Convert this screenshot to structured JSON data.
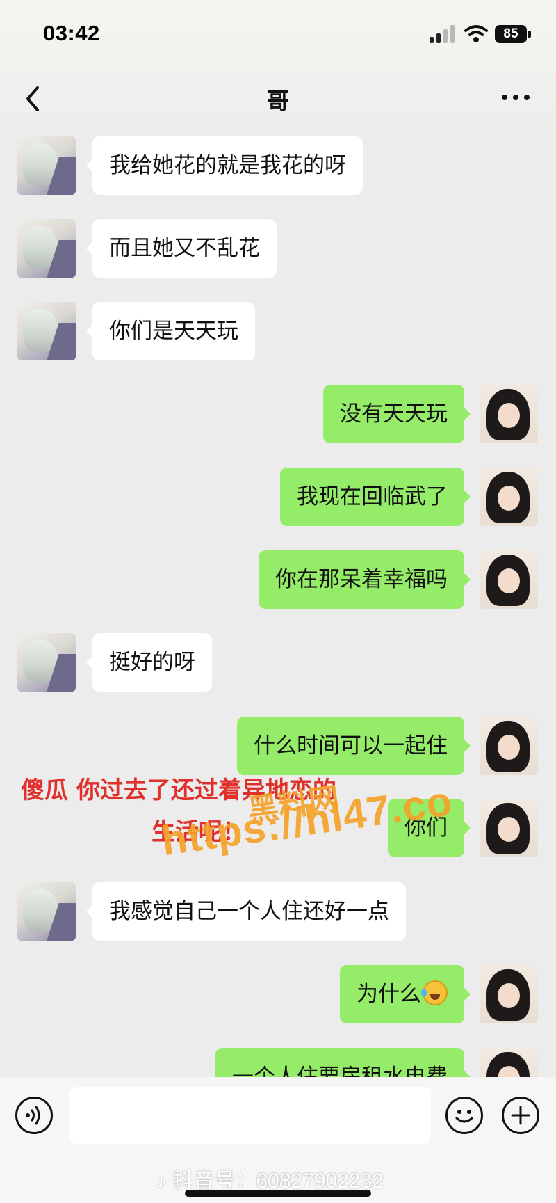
{
  "status_bar": {
    "time": "03:42",
    "battery": "85"
  },
  "header": {
    "title": "哥"
  },
  "messages": [
    {
      "side": "left",
      "text": "我给她花的就是我花的呀"
    },
    {
      "side": "left",
      "text": "而且她又不乱花"
    },
    {
      "side": "left",
      "text": "你们是天天玩"
    },
    {
      "side": "right",
      "text": "没有天天玩"
    },
    {
      "side": "right",
      "text": "我现在回临武了"
    },
    {
      "side": "right",
      "text": "你在那呆着幸福吗"
    },
    {
      "side": "left",
      "text": "挺好的呀"
    },
    {
      "side": "right",
      "text": "什么时间可以一起住"
    },
    {
      "side": "right",
      "text": "你们"
    },
    {
      "side": "left",
      "text": "我感觉自己一个人住还好一点"
    },
    {
      "side": "right",
      "text": "为什么",
      "emoji": "crying-laughing-emoji"
    },
    {
      "side": "right",
      "text": "一个人住要房租水电费"
    }
  ],
  "overlay": {
    "caption_line1": "傻瓜 你过去了还过着异地恋的",
    "caption_line2": "生活呢！",
    "watermark_site": "黑料网",
    "watermark_url": "https://hl47.co"
  },
  "footer": {
    "tiktok_id": "♪ 抖音号：60827902232"
  },
  "colors": {
    "self_bubble": "#95ec69",
    "other_bubble": "#ffffff",
    "background": "#ececec",
    "caption": "#e0302c",
    "watermark": "#f4a32a"
  }
}
